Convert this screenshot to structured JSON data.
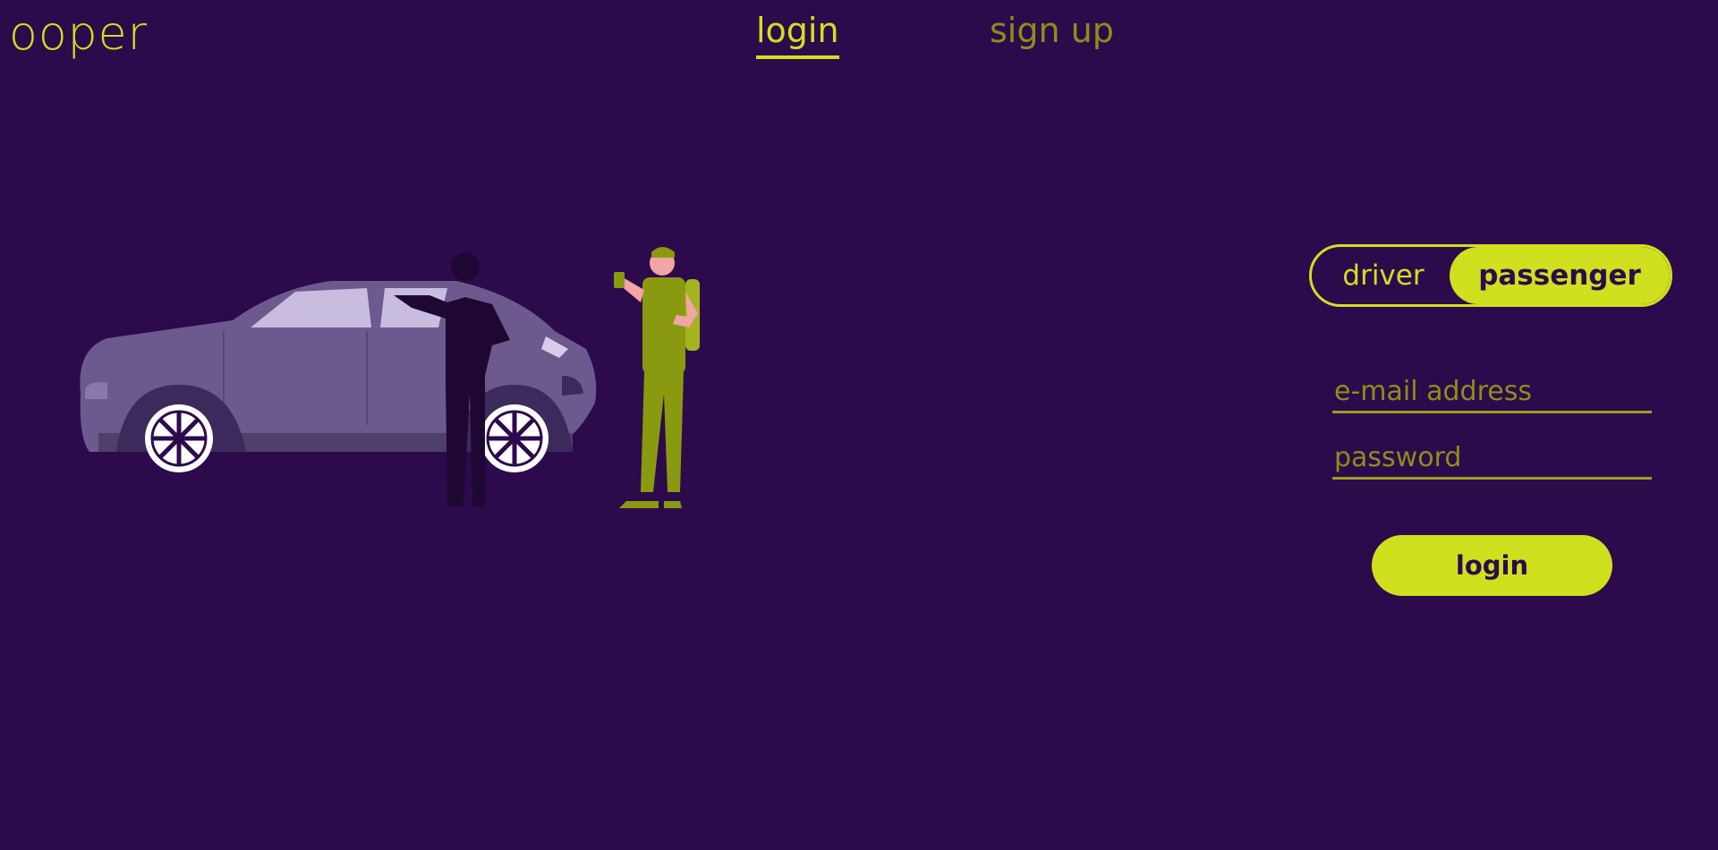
{
  "app": {
    "logo": "ooper"
  },
  "nav": {
    "tabs": [
      {
        "label": "login",
        "active": true
      },
      {
        "label": "sign up",
        "active": false
      }
    ]
  },
  "form": {
    "role_toggle": {
      "options": [
        "driver",
        "passenger"
      ],
      "selected": "passenger"
    },
    "email": {
      "placeholder": "e-mail address",
      "value": ""
    },
    "password": {
      "placeholder": "password",
      "value": ""
    },
    "submit_label": "login"
  },
  "colors": {
    "background": "#2d0a4c",
    "accent": "#cfe01e",
    "accent_muted": "#8c8f17",
    "car_body": "#6c5a8e",
    "passenger_clothes": "#8a9a10"
  },
  "illustration": {
    "subject": "car-with-driver-and-passenger"
  }
}
